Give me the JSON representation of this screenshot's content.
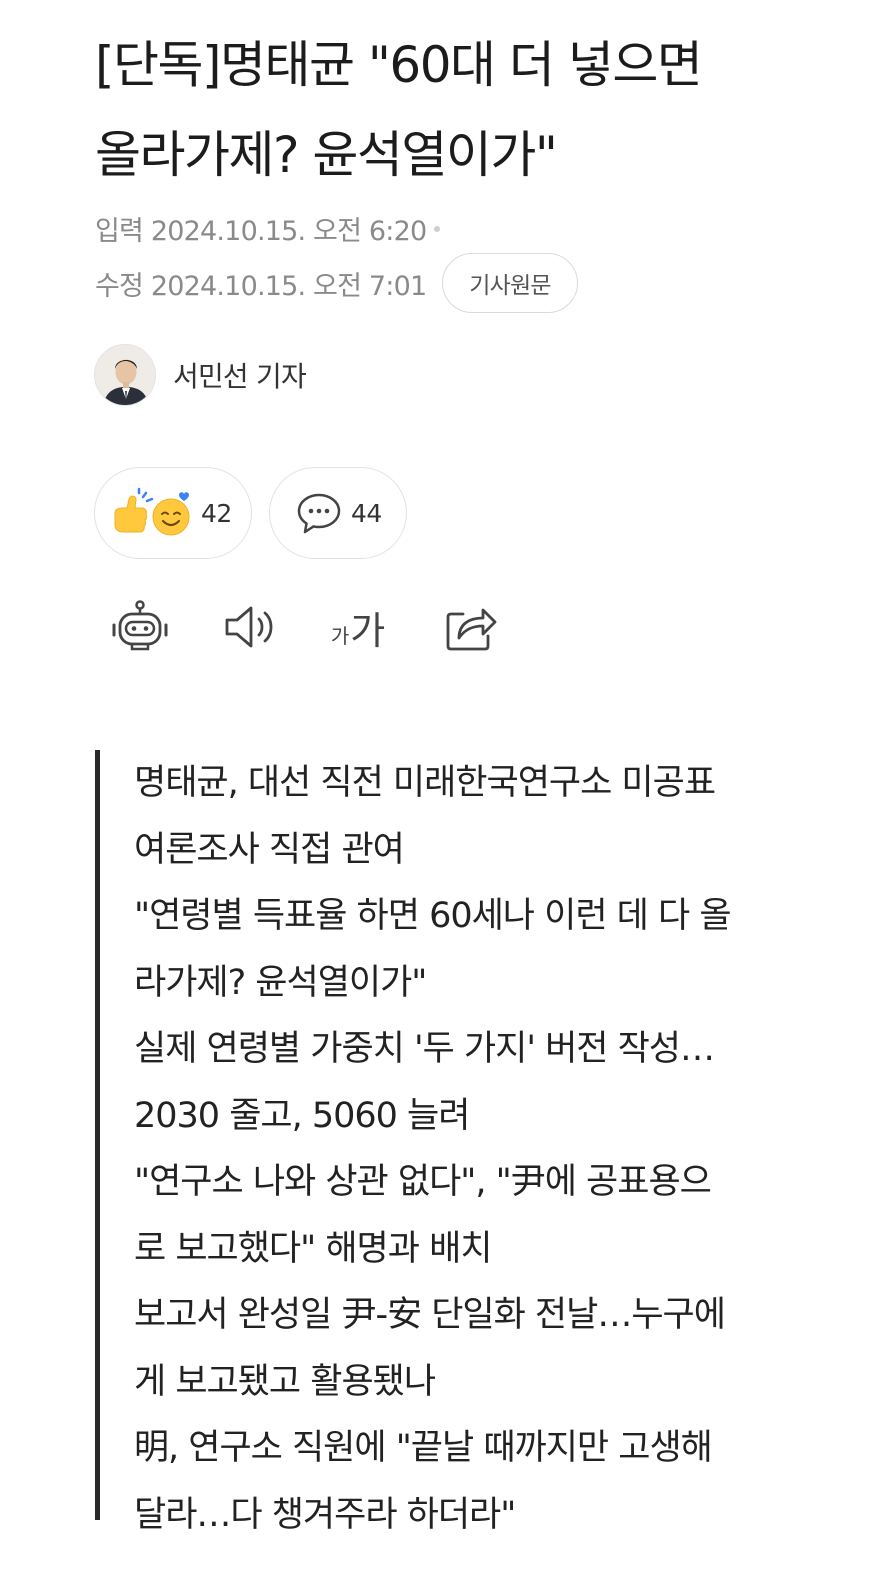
{
  "article": {
    "title_line1": "[단독]명태균 \"60대 더 넣으면",
    "title_line2": "올라가제? 윤석열이가\"",
    "published_label": "입력",
    "published_time": "2024.10.15. 오전 6:20",
    "modified_label": "수정",
    "modified_time": "2024.10.15. 오전 7:01",
    "original_button": "기사원문",
    "author": "서민선 기자"
  },
  "reactions": {
    "like_count": "42",
    "comment_count": "44"
  },
  "tools": {
    "font_size_small": "가",
    "font_size_large": "가",
    "icons": [
      "robot-summary-icon",
      "speaker-icon",
      "font-size-icon",
      "share-icon"
    ]
  },
  "summary_lines": [
    "명태균, 대선 직전 미래한국연구소 미공표",
    "여론조사 직접 관여",
    "\"연령별 득표율 하면 60세나 이런 데 다 올",
    "라가제? 윤석열이가\"",
    "실제 연령별 가중치 '두 가지' 버전 작성…",
    "2030 줄고, 5060 늘려",
    "\"연구소 나와 상관 없다\", \"尹에 공표용으",
    "로 보고했다\" 해명과 배치",
    "보고서 완성일 尹-安 단일화 전날…누구에",
    "게 보고됐고 활용됐나",
    "明, 연구소 직원에 \"끝날 때까지만 고생해",
    "달라…다 챙겨주라 하더라\""
  ]
}
